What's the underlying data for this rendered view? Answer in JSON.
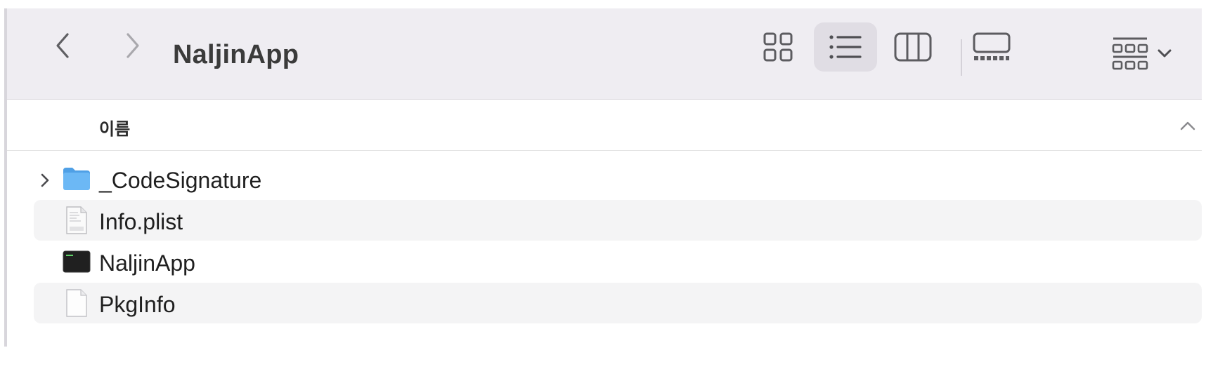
{
  "window": {
    "title": "NaljinApp"
  },
  "toolbar": {
    "back_icon": "chevron-left-icon",
    "forward_icon": "chevron-right-icon",
    "views": [
      {
        "name": "icon-view",
        "icon": "grid-icon",
        "active": false
      },
      {
        "name": "list-view",
        "icon": "list-icon",
        "active": true
      },
      {
        "name": "column-view",
        "icon": "columns-icon",
        "active": false
      },
      {
        "name": "gallery-view",
        "icon": "gallery-icon",
        "active": false
      }
    ],
    "group_icon": "group-icon",
    "group_chevron": "chevron-down-icon"
  },
  "list": {
    "column_header": "이름",
    "sort_direction": "ascending",
    "items": [
      {
        "name": "_CodeSignature",
        "kind": "folder",
        "icon": "folder-icon",
        "expandable": true
      },
      {
        "name": "Info.plist",
        "kind": "plist",
        "icon": "plist-file-icon",
        "expandable": false
      },
      {
        "name": "NaljinApp",
        "kind": "executable",
        "icon": "terminal-exec-icon",
        "expandable": false
      },
      {
        "name": "PkgInfo",
        "kind": "document",
        "icon": "blank-document-icon",
        "expandable": false
      }
    ]
  },
  "colors": {
    "toolbar_bg": "#efedf2",
    "active_view_bg": "#e0dde4",
    "alt_row_bg": "#f4f4f5",
    "folder_blue": "#5aaef0"
  }
}
